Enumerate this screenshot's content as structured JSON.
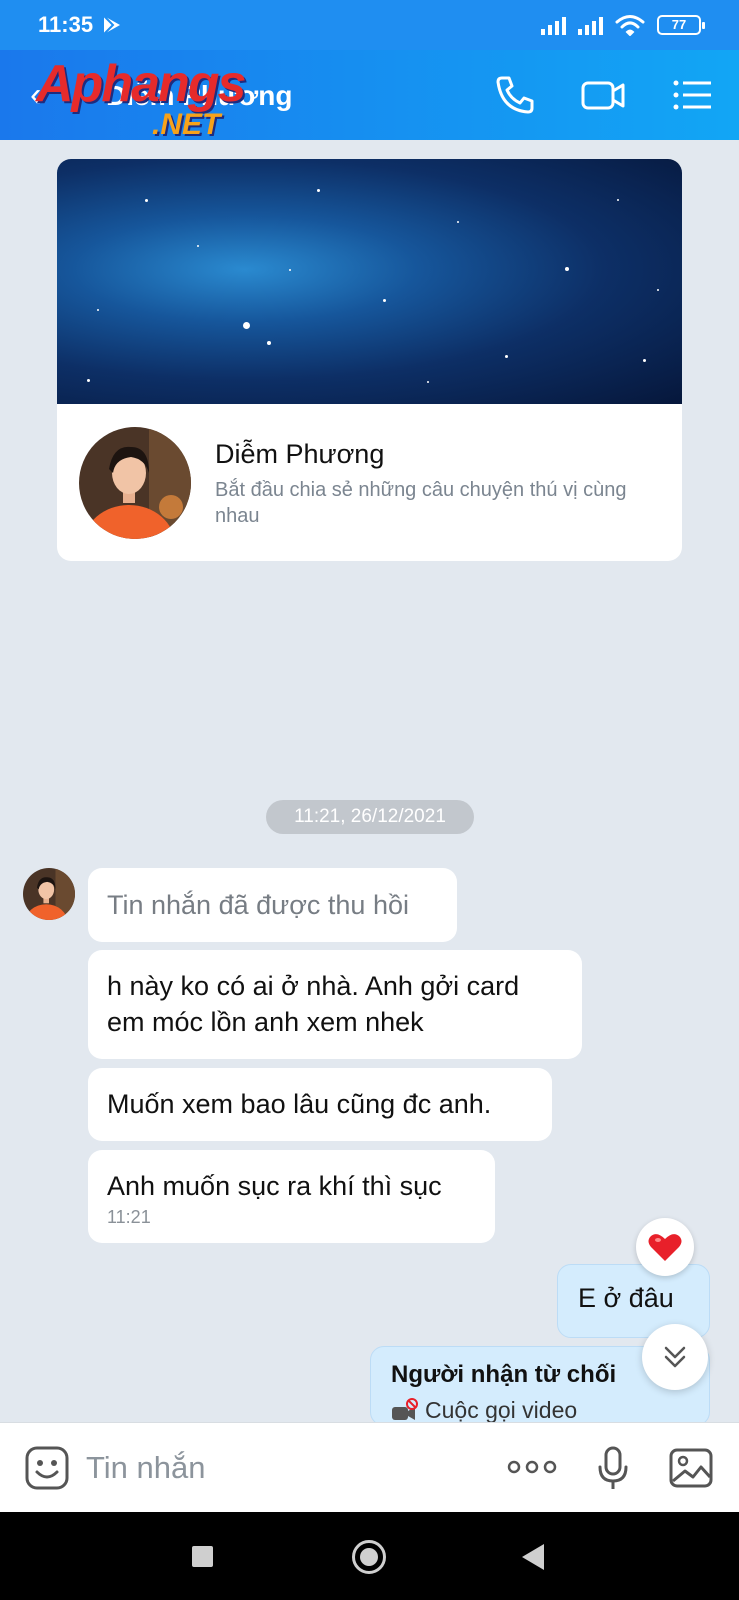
{
  "status_bar": {
    "time": "11:35",
    "battery": "77"
  },
  "header": {
    "title": "Diễm Phương",
    "watermark_top": "Aphangs",
    "watermark_bottom": ".NET"
  },
  "profile": {
    "name": "Diễm Phương",
    "description": "Bắt đầu chia sẻ những câu chuyện thú vị cùng nhau"
  },
  "conversation": {
    "timestamp": "11:21, 26/12/2021",
    "incoming": [
      {
        "text": "Tin nhắn đã được thu hồi",
        "recalled": true
      },
      {
        "text": "h này ko có ai ở nhà. Anh gởi card em móc lồn anh xem nhek"
      },
      {
        "text": "Muốn xem bao lâu cũng đc anh."
      },
      {
        "text": "Anh muốn sục ra khí thì sục",
        "time": "11:21"
      }
    ],
    "outgoing": [
      {
        "text": "E ở đâu",
        "reaction": "heart"
      }
    ],
    "call_card": {
      "title": "Người nhận từ chối",
      "subtitle": "Cuộc gọi video"
    }
  },
  "input_bar": {
    "placeholder": "Tin nhắn"
  },
  "colors": {
    "header_gradient_start": "#1a78ec",
    "header_gradient_end": "#12a6f5",
    "chat_background": "#e2e8ef",
    "outgoing_bubble": "#d4ecfd",
    "reaction_heart": "#e8202a"
  },
  "icons": {
    "header": [
      "back-arrow-icon",
      "phone-icon",
      "video-camera-icon",
      "list-menu-icon"
    ],
    "input_bar": [
      "sticker-emoji-icon",
      "more-dots-icon",
      "microphone-icon",
      "image-icon"
    ],
    "system_nav": [
      "recent-apps-icon",
      "home-icon",
      "back-icon"
    ]
  }
}
